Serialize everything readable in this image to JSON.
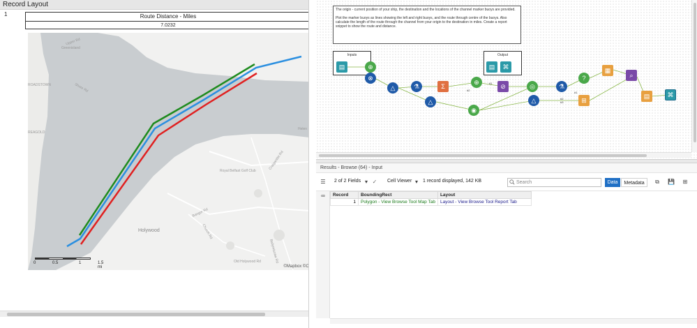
{
  "report": {
    "header": "Record Layout",
    "row_number": "1",
    "distance_title": "Route Distance - Miles",
    "distance_value": "7.0232"
  },
  "map": {
    "labels": [
      "Upper Rd",
      "Greenisland",
      "ROADSTOWN",
      "Shore Rd",
      "REAGOLD",
      "Royal Belfast Golf Club",
      "Craigantlet Rd",
      "Holywood",
      "Bangor Rd",
      "Church Rd",
      "Ballymiscaw Rd",
      "Old Holywood Rd",
      "Helen"
    ],
    "scale_ticks": [
      "0",
      "0.5",
      "1",
      "1.5 mi"
    ],
    "attribution": "©Mapbox ©O",
    "route_colors": {
      "left": "#1e8b1e",
      "route": "#2b8fe0",
      "right": "#e02020"
    }
  },
  "workflow": {
    "comment": "The origin - current position of your ship, the destination and the locations of the channel marker buoys are provided.\n\nPlot the marker buoys as lines showing the left and right buoys, and the route through centre of the buoys. Also calculate the length of the route through the channel from your origin to the destination in miles. Create a report snippet to show the route and distance.",
    "inputs_label": "Inputs",
    "output_label": "Output",
    "connection_labels": [
      "#1",
      "#2",
      "#1",
      "#2",
      "#3"
    ]
  },
  "results": {
    "title": "Results - Browse (64) - Input",
    "fields": "2 of 2 Fields",
    "viewer": "Cell Viewer",
    "record_info": "1 record displayed, 142 KB",
    "search_placeholder": "Search",
    "btn_data": "Data",
    "btn_metadata": "Metadata",
    "columns": [
      "Record",
      "BoundingRect",
      "Layout"
    ],
    "rows": [
      {
        "record": "1",
        "bounding": "Polygon - View Browse Tool Map Tab",
        "layout": "Layout - View Browse Tool Report Tab"
      }
    ]
  }
}
